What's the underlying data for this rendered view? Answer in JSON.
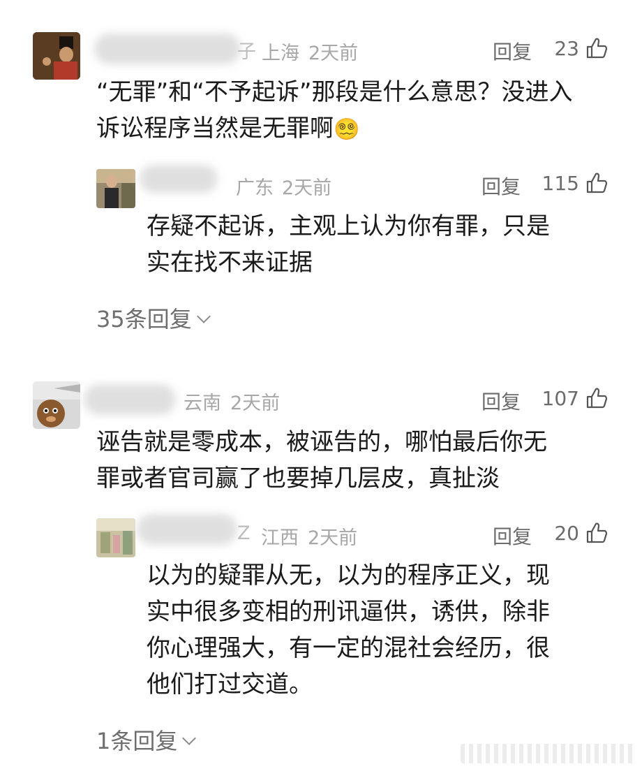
{
  "comments": [
    {
      "location": "上海",
      "time": "2天前",
      "name_tail": "子",
      "reply_label": "回复",
      "likes": "23",
      "lines": [
        "“无罪”和“不予起诉”那段是什么意思？没进入",
        "诉讼程序当然是无罪啊"
      ],
      "emoji": "😵‍💫",
      "sub": {
        "location": "广东",
        "time": "2天前",
        "reply_label": "回复",
        "likes": "115",
        "lines": [
          "存疑不起诉，主观上认为你有罪，只是",
          "实在找不来证据"
        ]
      },
      "more_replies": "35条回复"
    },
    {
      "location": "云南",
      "time": "2天前",
      "reply_label": "回复",
      "likes": "107",
      "lines": [
        "诬告就是零成本，被诬告的，哪怕最后你无",
        "罪或者官司赢了也要掉几层皮，真扯淡"
      ],
      "sub": {
        "location": "江西",
        "time": "2天前",
        "name_tail": "Z",
        "reply_label": "回复",
        "likes": "20",
        "lines": [
          "以为的疑罪从无，以为的程序正义，现",
          "实中很多变相的刑讯逼供，诱供，除非",
          "你心理强大，有一定的混社会经历，很",
          "他们打过交道。"
        ]
      },
      "more_replies": "1条回复"
    }
  ]
}
